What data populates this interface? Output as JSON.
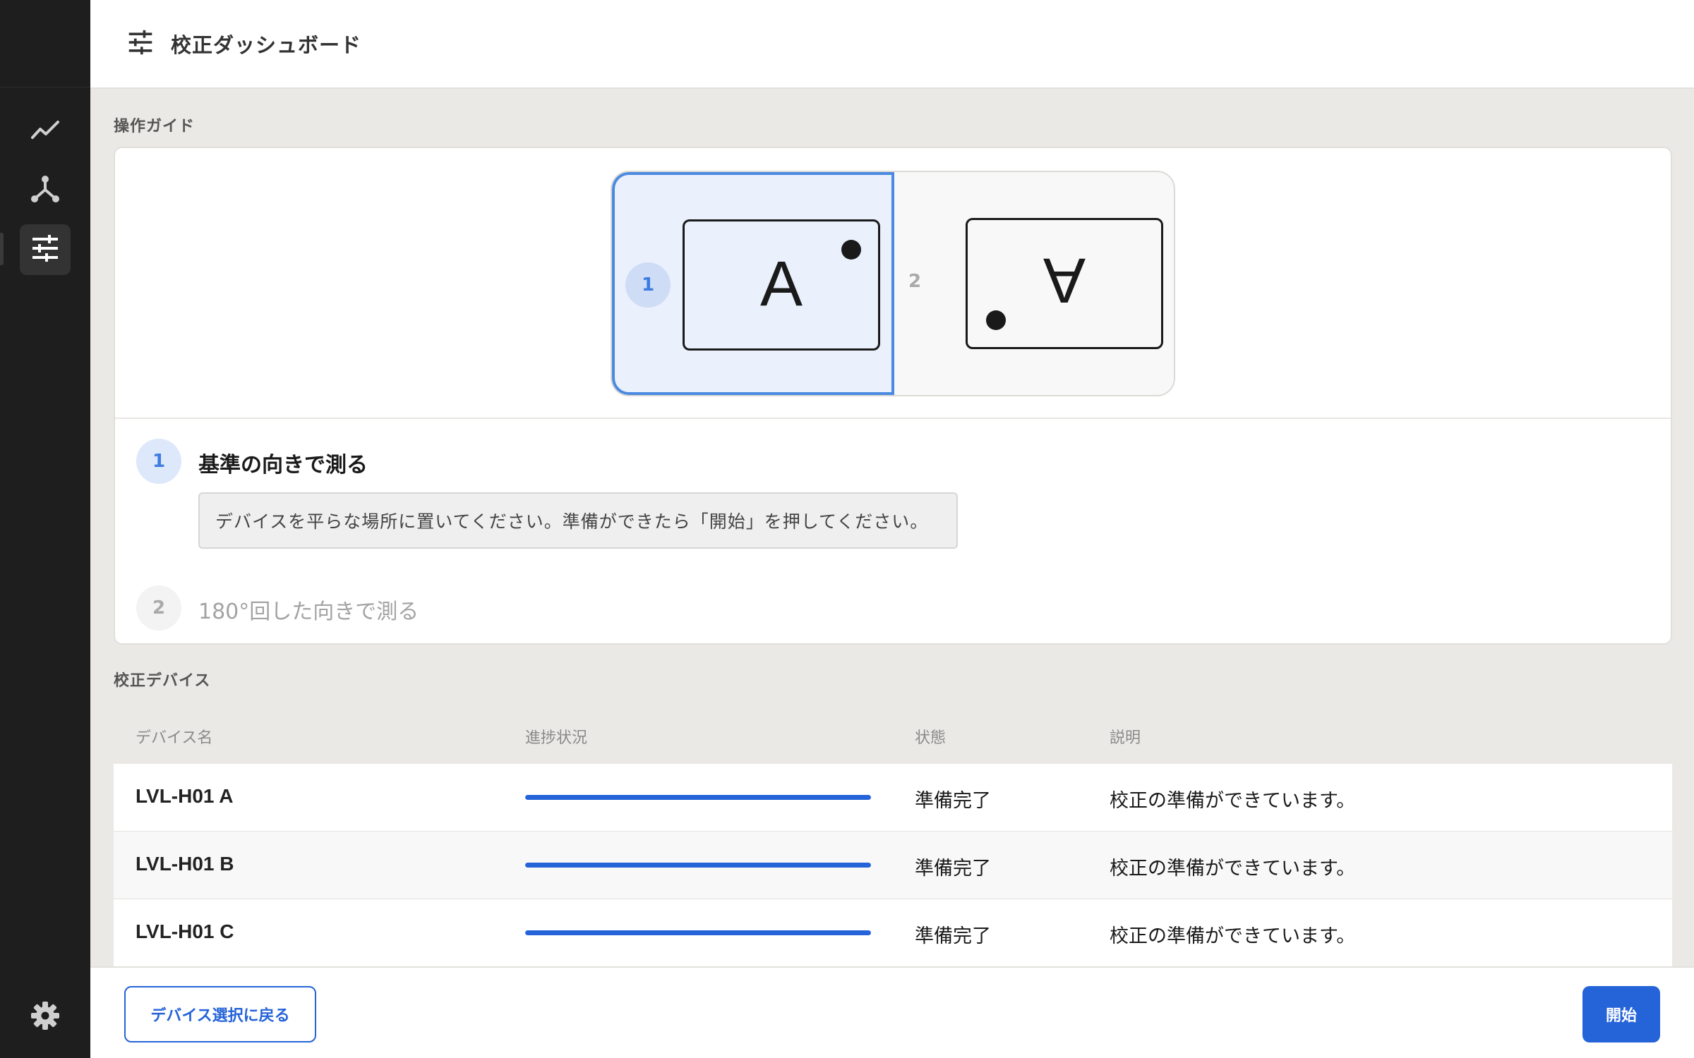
{
  "header": {
    "title": "校正ダッシュボード",
    "icon": "sliders-icon"
  },
  "sidebar": {
    "items": [
      {
        "name": "chart",
        "icon": "trend-line-icon",
        "active": false
      },
      {
        "name": "network",
        "icon": "network-fork-icon",
        "active": false
      },
      {
        "name": "calibration",
        "icon": "sliders-icon",
        "active": true
      }
    ],
    "settings_icon": "gear-icon"
  },
  "guide": {
    "section_label": "操作ガイド",
    "orientation": {
      "step1_number": "1",
      "step1_letter": "A",
      "step2_number": "2",
      "step2_letter": "A"
    },
    "steps": [
      {
        "number": "1",
        "title": "基準の向きで測る",
        "description": "デバイスを平らな場所に置いてください。準備ができたら「開始」を押してください。",
        "active": true
      },
      {
        "number": "2",
        "title": "180°回した向きで測る",
        "active": false
      }
    ]
  },
  "devices": {
    "section_label": "校正デバイス",
    "columns": [
      "デバイス名",
      "進捗状況",
      "状態",
      "説明"
    ],
    "rows": [
      {
        "name": "LVL-H01 A",
        "progress": 1.0,
        "status": "準備完了",
        "description": "校正の準備ができています。"
      },
      {
        "name": "LVL-H01 B",
        "progress": 1.0,
        "status": "準備完了",
        "description": "校正の準備ができています。"
      },
      {
        "name": "LVL-H01 C",
        "progress": 1.0,
        "status": "準備完了",
        "description": "校正の準備ができています。"
      }
    ]
  },
  "footer": {
    "back_label": "デバイス選択に戻る",
    "start_label": "開始"
  },
  "colors": {
    "accent": "#2563d8",
    "sidebar_bg": "#1e1e1e",
    "active_step_bg": "#eaf0fc"
  }
}
